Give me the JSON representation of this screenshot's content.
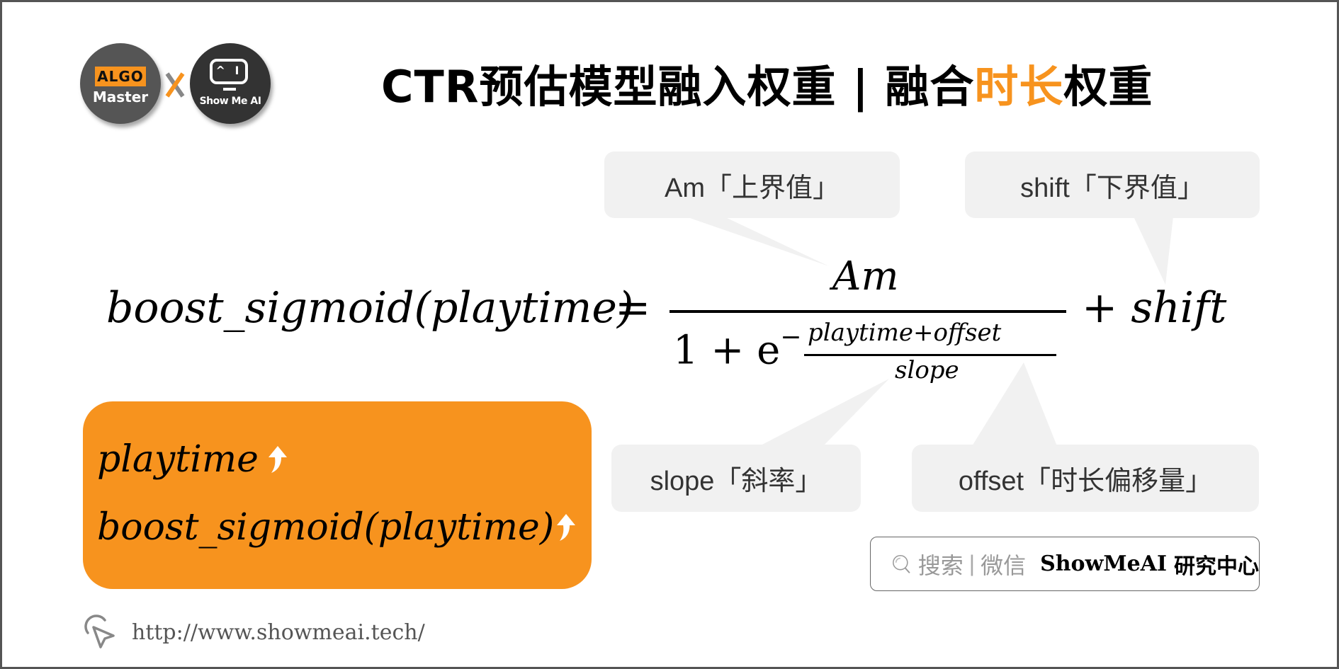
{
  "logos": {
    "algo_badge": "ALGO",
    "algo_sub": "Master",
    "cross": "x",
    "showmeai_screen": "^ I",
    "showmeai_name": "Show Me AI"
  },
  "title": {
    "prefix": "CTR预估模型融入权重 | 融合",
    "accent": "时长",
    "suffix": "权重"
  },
  "colors": {
    "accent": "#F7931E",
    "callout_bg": "#F1F1F1",
    "frame_border": "#555555",
    "logo_dark": "#333333",
    "logo_gray": "#555555"
  },
  "formula": {
    "lhs": "boost_sigmoid(playtime)",
    "equals": "=",
    "numerator": "Am",
    "denominator_base": "1 + e",
    "exponent_sign": "−",
    "exponent_numerator": "playtime+offset",
    "exponent_denominator": "slope",
    "plus": "+",
    "shift": "shift"
  },
  "callouts": {
    "am": "Am「上界值」",
    "shift": "shift「下界值」",
    "slope": "slope「斜率」",
    "offset": "offset「时长偏移量」"
  },
  "orange_box": {
    "line1": "playtime",
    "line2": "boost_sigmoid(playtime)",
    "arrow_icon": "up-arrow-icon"
  },
  "search_box": {
    "icon": "search-icon",
    "hint1": "搜索",
    "separator": "|",
    "hint2": "微信",
    "brand": "ShowMeAI",
    "brand_suffix": "研究中心"
  },
  "footer": {
    "icon": "cursor-click-icon",
    "url": "http://www.showmeai.tech/"
  }
}
